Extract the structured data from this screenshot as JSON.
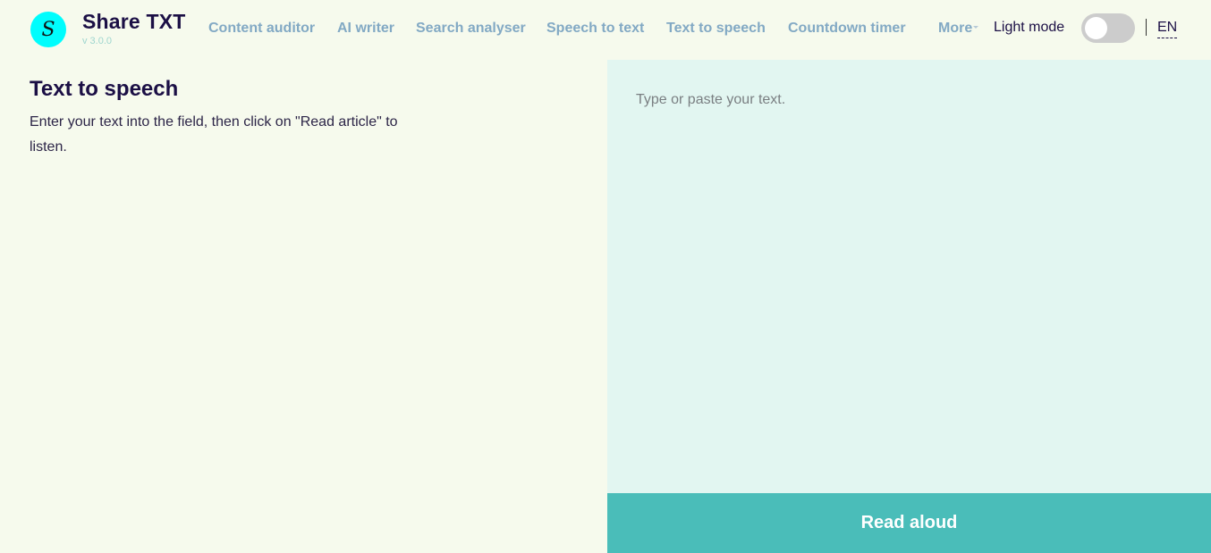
{
  "header": {
    "logo_letter": "S",
    "brand": "Share TXT",
    "version": "v 3.0.0",
    "nav": [
      {
        "label": "Content auditor"
      },
      {
        "label": "AI writer"
      },
      {
        "label": "Search analyser"
      },
      {
        "label": "Speech to text"
      },
      {
        "label": "Text to speech"
      },
      {
        "label": "Countdown timer"
      }
    ],
    "more_label": "More",
    "mode_label": "Light mode",
    "mode_toggle_on": false,
    "language": "EN"
  },
  "main": {
    "title": "Text to speech",
    "description": "Enter your text into the field, then click on \"Read article\" to listen.",
    "editor": {
      "placeholder": "Type or paste your text.",
      "value": ""
    },
    "read_button_label": "Read aloud"
  },
  "colors": {
    "page_bg": "#f6faed",
    "editor_bg": "#e2f6f1",
    "accent": "#4abdb9",
    "logo_bg": "#00fdfd",
    "nav_link": "#82a9c4",
    "heading": "#1b0f45"
  }
}
